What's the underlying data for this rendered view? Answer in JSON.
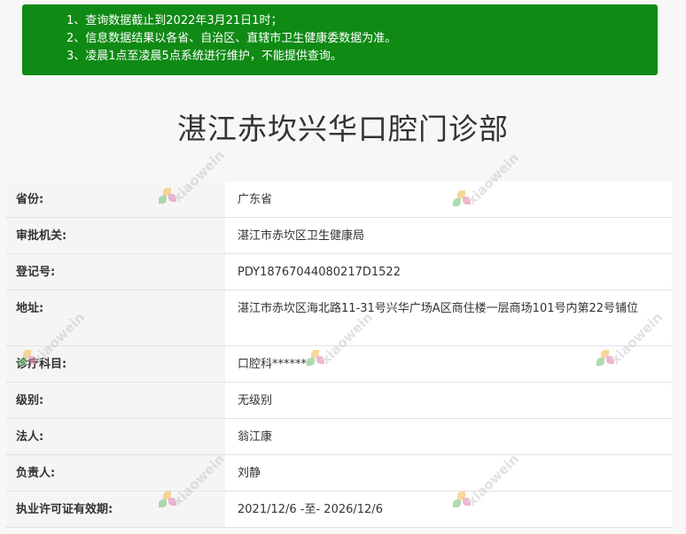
{
  "notice": {
    "lines": [
      "1、查询数据截止到2022年3月21日1时；",
      "2、信息数据结果以各省、自治区、直辖市卫生健康委数据为准。",
      "3、凌晨1点至凌晨5点系统进行维护，不能提供查询。"
    ]
  },
  "page_title": "湛江赤坎兴华口腔门诊部",
  "details": [
    {
      "label": "省份:",
      "value": "广东省"
    },
    {
      "label": "审批机关:",
      "value": "湛江市赤坎区卫生健康局"
    },
    {
      "label": "登记号:",
      "value": "PDY18767044080217D1522"
    },
    {
      "label": "地址:",
      "value": "湛江市赤坎区海北路11-31号兴华广场A区商住楼一层商场101号内第22号铺位"
    },
    {
      "label": "诊疗科目:",
      "value": "口腔科******"
    },
    {
      "label": "级别:",
      "value": "无级别"
    },
    {
      "label": "法人:",
      "value": "翁江康"
    },
    {
      "label": "负责人:",
      "value": "刘静"
    },
    {
      "label": "执业许可证有效期:",
      "value": "2021/12/6 -至- 2026/12/6"
    }
  ],
  "watermark": {
    "text": "xiaowein",
    "icon": "flower-logo-icon"
  },
  "colors": {
    "notice_bg": "#0f8a14",
    "label_bg": "#f5f5f5",
    "value_bg": "#ffffff",
    "divider": "#e2e2e2"
  }
}
